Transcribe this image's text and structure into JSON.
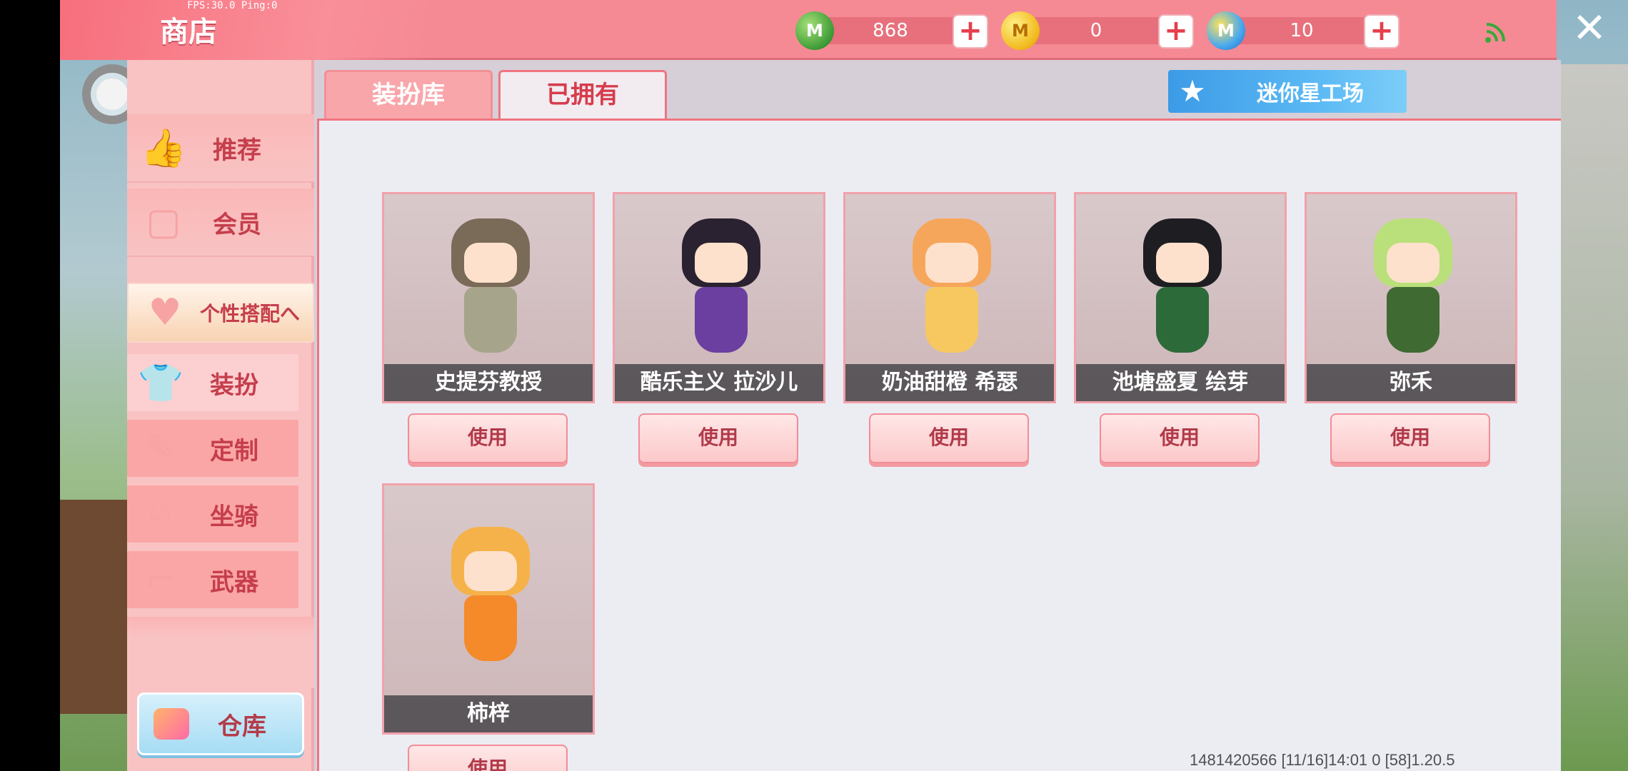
{
  "header": {
    "fps_text": "FPS:30.0  Ping:0",
    "title": "商店",
    "currencies": [
      {
        "name": "mini-bean",
        "amount": "868",
        "color": "#3c9b35"
      },
      {
        "name": "mini-coin",
        "amount": "0",
        "color": "#f1b81a"
      },
      {
        "name": "star-coin",
        "amount": "10",
        "color": "#49a9f0"
      }
    ],
    "close_glyph": "✕"
  },
  "sidebar": {
    "items": [
      {
        "label": "推荐",
        "icon": "thumbs-up-icon"
      },
      {
        "label": "会员",
        "icon": "vip-card-icon"
      },
      {
        "label": "个性搭配へ",
        "icon": "gift-icon"
      },
      {
        "label": "装扮",
        "icon": "shirt-icon"
      },
      {
        "label": "定制",
        "icon": "pencil-icon"
      },
      {
        "label": "坐骑",
        "icon": "mount-icon"
      },
      {
        "label": "武器",
        "icon": "gun-icon"
      }
    ],
    "warehouse_label": "仓库"
  },
  "tabs": [
    {
      "label": "装扮库",
      "active": false
    },
    {
      "label": "已拥有",
      "active": true
    }
  ],
  "studio_button": "迷你星工场",
  "cards": [
    {
      "name": "史提芬教授",
      "use_label": "使用",
      "hair": "#e8e0d0",
      "outfit": "#7f8a70"
    },
    {
      "name": "酷乐主义 拉沙儿",
      "use_label": "使用",
      "hair": "#2a2230",
      "outfit": "#6a3fa0"
    },
    {
      "name": "奶油甜橙 希瑟",
      "use_label": "使用",
      "hair": "#f6a65a",
      "outfit": "#f7c860"
    },
    {
      "name": "池塘盛夏 绘芽",
      "use_label": "使用",
      "hair": "#1e1e22",
      "outfit": "#2d6a3a"
    },
    {
      "name": "弥禾",
      "use_label": "使用",
      "hair": "#b9e07a",
      "outfit": "#3f6a32"
    },
    {
      "name": "柿梓",
      "use_label": "使用",
      "hair": "#f5b24a",
      "outfit": "#f58a2a"
    }
  ],
  "footer": "1481420566   [11/16]14:01 0     [58]1.20.5"
}
